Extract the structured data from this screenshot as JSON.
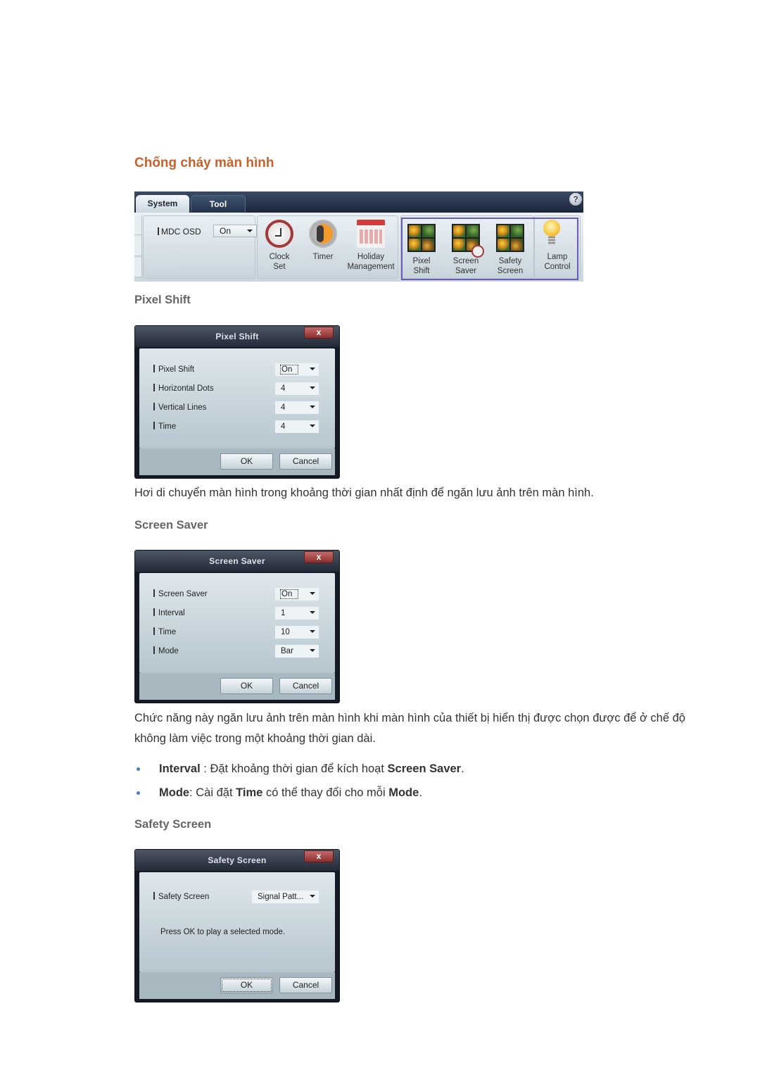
{
  "page_title": "Chống cháy màn hình",
  "toolbar": {
    "tabs": [
      "System",
      "Tool"
    ],
    "active_tab": "System",
    "help_label": "?",
    "mdc_osd": {
      "label": "MDC OSD",
      "value": "On"
    },
    "buttons": [
      {
        "id": "clock-set",
        "label_1": "Clock",
        "label_2": "Set",
        "icon": "clock-icon"
      },
      {
        "id": "timer",
        "label_1": "Timer",
        "label_2": "",
        "icon": "timer-icon"
      },
      {
        "id": "holiday",
        "label_1": "Holiday",
        "label_2": "Management",
        "icon": "calendar-icon"
      },
      {
        "id": "pixel-shift",
        "label_1": "Pixel",
        "label_2": "Shift",
        "icon": "pixel-shift-icon"
      },
      {
        "id": "screen-saver",
        "label_1": "Screen",
        "label_2": "Saver",
        "icon": "screen-saver-icon"
      },
      {
        "id": "safety-screen",
        "label_1": "Safety",
        "label_2": "Screen",
        "icon": "safety-screen-icon"
      },
      {
        "id": "lamp-control",
        "label_1": "Lamp",
        "label_2": "Control",
        "icon": "lightbulb-icon"
      }
    ],
    "highlight_color": "#6a5bb8"
  },
  "sections": {
    "pixel_shift": {
      "heading": "Pixel Shift",
      "dialog": {
        "title": "Pixel Shift",
        "close": "x",
        "rows": [
          {
            "label": "Pixel Shift",
            "value": "On"
          },
          {
            "label": "Horizontal Dots",
            "value": "4"
          },
          {
            "label": "Vertical Lines",
            "value": "4"
          },
          {
            "label": "Time",
            "value": "4"
          }
        ],
        "ok": "OK",
        "cancel": "Cancel"
      },
      "description": "Hơi di chuyển màn hình trong khoảng thời gian nhất định để ngăn lưu ảnh trên màn hình."
    },
    "screen_saver": {
      "heading": "Screen Saver",
      "dialog": {
        "title": "Screen Saver",
        "close": "x",
        "rows": [
          {
            "label": "Screen Saver",
            "value": "On"
          },
          {
            "label": "Interval",
            "value": "1"
          },
          {
            "label": "Time",
            "value": "10"
          },
          {
            "label": "Mode",
            "value": "Bar"
          }
        ],
        "ok": "OK",
        "cancel": "Cancel"
      },
      "description": "Chức năng này ngăn lưu ảnh trên màn hình khi màn hình của thiết bị hiển thị được chọn được để ở chế độ không làm việc trong một khoảng thời gian dài.",
      "bullets": [
        {
          "b1": "Interval",
          "t1": " : Đặt khoảng thời gian để kích hoạt ",
          "b2": "Screen Saver",
          "t2": "."
        },
        {
          "b1": "Mode",
          "t1": ": Cài đặt ",
          "b2": "Time",
          "t2": " có thể thay đổi cho mỗi ",
          "b3": "Mode",
          "t3": "."
        }
      ]
    },
    "safety_screen": {
      "heading": "Safety Screen",
      "dialog": {
        "title": "Safety Screen",
        "close": "x",
        "rows": [
          {
            "label": "Safety Screen",
            "value": "Signal Patt..."
          }
        ],
        "message": "Press OK to play a selected mode.",
        "ok": "OK",
        "cancel": "Cancel"
      }
    }
  },
  "colors": {
    "title": "#c8612a",
    "heading": "#666666",
    "bullet": "#4a7fc1",
    "close_button": "#a84343"
  }
}
